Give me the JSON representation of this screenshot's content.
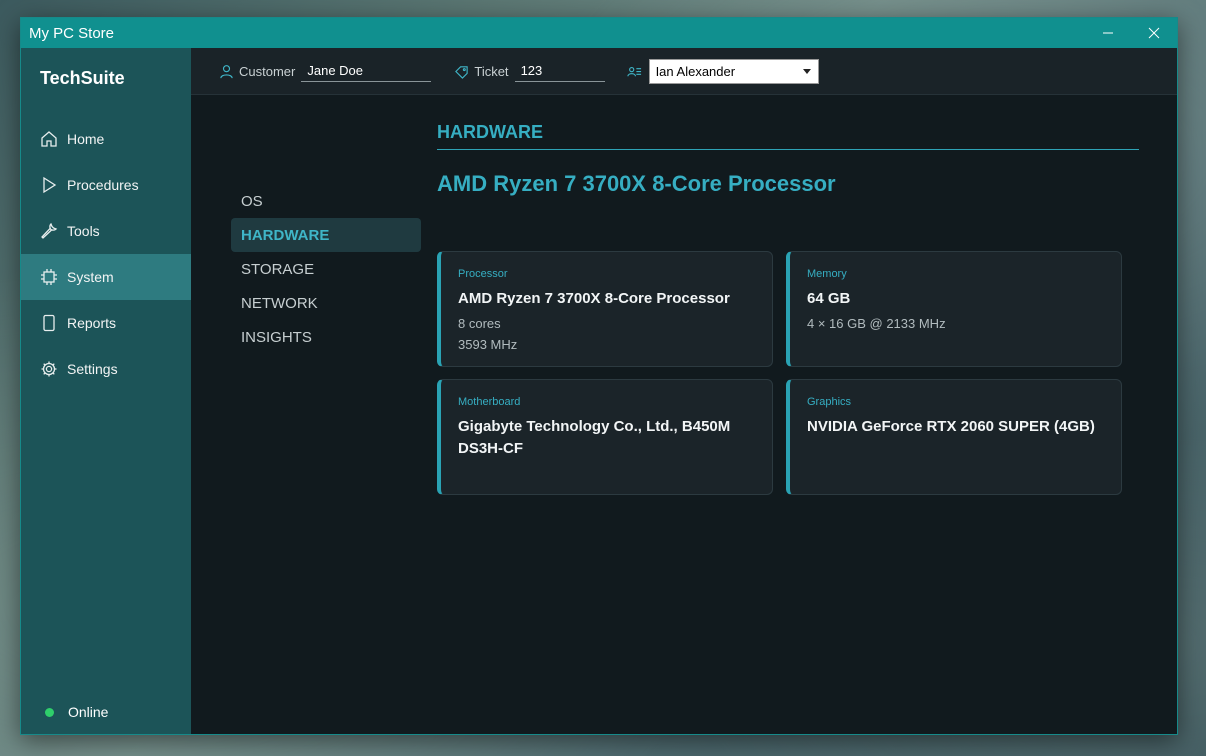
{
  "window": {
    "title": "My PC Store"
  },
  "sidebar": {
    "brand": "TechSuite",
    "items": [
      {
        "label": "Home"
      },
      {
        "label": "Procedures"
      },
      {
        "label": "Tools"
      },
      {
        "label": "System"
      },
      {
        "label": "Reports"
      },
      {
        "label": "Settings"
      }
    ],
    "active": "System",
    "status": "Online"
  },
  "topbar": {
    "customer_label": "Customer",
    "customer_value": "Jane Doe",
    "ticket_label": "Ticket",
    "ticket_value": "123",
    "technician_value": "Ian Alexander"
  },
  "subnav": {
    "items": [
      {
        "label": "OS"
      },
      {
        "label": "HARDWARE"
      },
      {
        "label": "STORAGE"
      },
      {
        "label": "NETWORK"
      },
      {
        "label": "INSIGHTS"
      }
    ],
    "active": "HARDWARE"
  },
  "content": {
    "section_title": "HARDWARE",
    "headline": "AMD Ryzen 7 3700X 8-Core Processor",
    "cards": [
      {
        "label": "Processor",
        "value": "AMD Ryzen 7 3700X 8-Core Processor",
        "lines": [
          "8 cores",
          "3593 MHz"
        ]
      },
      {
        "label": "Memory",
        "value": "64 GB",
        "lines": [
          "4 × 16 GB @ 2133 MHz"
        ]
      },
      {
        "label": "Motherboard",
        "value": "Gigabyte Technology Co., Ltd., B450M DS3H-CF",
        "lines": []
      },
      {
        "label": "Graphics",
        "value": "NVIDIA GeForce RTX 2060 SUPER (4GB)",
        "lines": []
      }
    ]
  },
  "colors": {
    "accent": "#36aec2",
    "titlebar": "#10908f",
    "sidebar": "#1c5458",
    "status": "#2fcf6b"
  }
}
